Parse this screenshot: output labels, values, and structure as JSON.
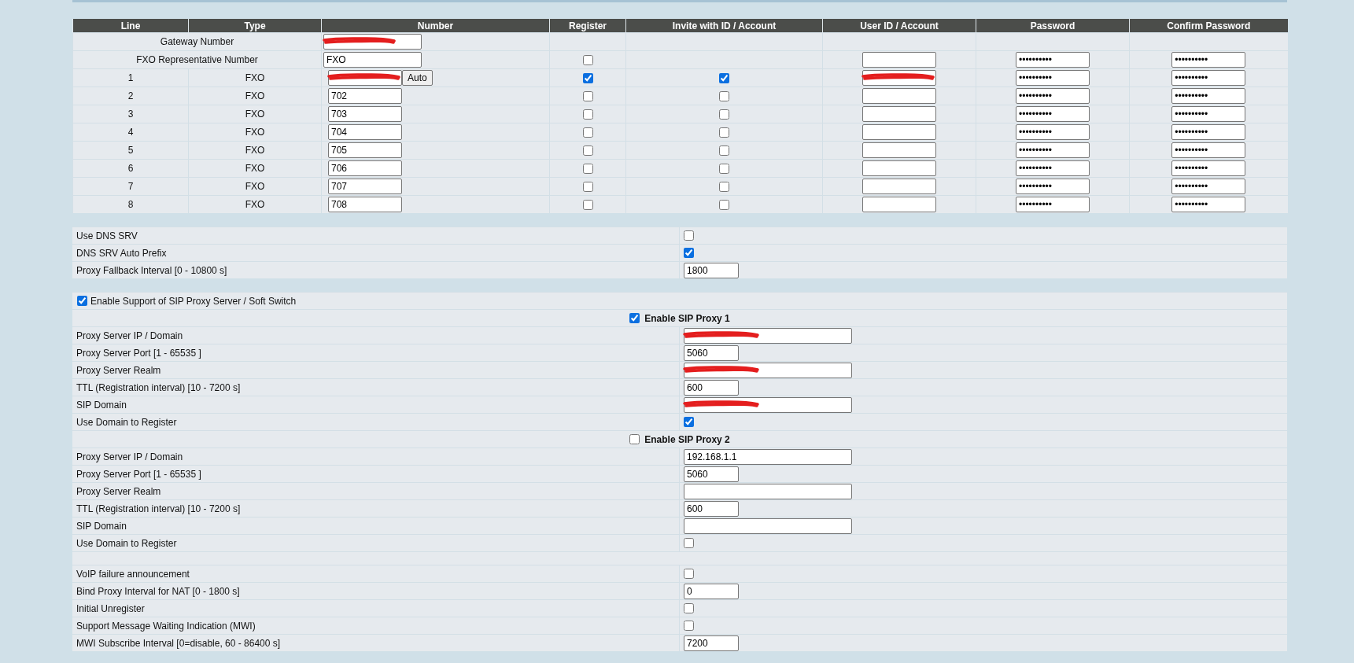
{
  "line_table": {
    "columns": [
      "Line",
      "Type",
      "Number",
      "Register",
      "Invite with ID / Account",
      "User ID / Account",
      "Password",
      "Confirm Password"
    ],
    "gateway_row": {
      "label": "Gateway Number",
      "number": {
        "redacted": true
      }
    },
    "representative_row": {
      "label": "FXO Representative Number",
      "number": {
        "value": "FXO",
        "redacted": false
      },
      "register": false,
      "user_id": {
        "redacted": false
      },
      "password": "••••••••••",
      "confirm_password": "••••••••••"
    },
    "lines": [
      {
        "line": "1",
        "type": "FXO",
        "number": {
          "redacted": true
        },
        "auto_button": "Auto",
        "register": true,
        "invite_with_id": true,
        "user_id": {
          "redacted": true
        },
        "password": "••••••••••",
        "confirm_password": "••••••••••"
      },
      {
        "line": "2",
        "type": "FXO",
        "number": {
          "value": "702",
          "redacted": false
        },
        "register": false,
        "invite_with_id": false,
        "user_id": {
          "redacted": false
        },
        "password": "••••••••••",
        "confirm_password": "••••••••••"
      },
      {
        "line": "3",
        "type": "FXO",
        "number": {
          "value": "703",
          "redacted": false
        },
        "register": false,
        "invite_with_id": false,
        "user_id": {
          "redacted": false
        },
        "password": "••••••••••",
        "confirm_password": "••••••••••"
      },
      {
        "line": "4",
        "type": "FXO",
        "number": {
          "value": "704",
          "redacted": false
        },
        "register": false,
        "invite_with_id": false,
        "user_id": {
          "redacted": false
        },
        "password": "••••••••••",
        "confirm_password": "••••••••••"
      },
      {
        "line": "5",
        "type": "FXO",
        "number": {
          "value": "705",
          "redacted": false
        },
        "register": false,
        "invite_with_id": false,
        "user_id": {
          "redacted": false
        },
        "password": "••••••••••",
        "confirm_password": "••••••••••"
      },
      {
        "line": "6",
        "type": "FXO",
        "number": {
          "value": "706",
          "redacted": false
        },
        "register": false,
        "invite_with_id": false,
        "user_id": {
          "redacted": false
        },
        "password": "••••••••••",
        "confirm_password": "••••••••••"
      },
      {
        "line": "7",
        "type": "FXO",
        "number": {
          "value": "707",
          "redacted": false
        },
        "register": false,
        "invite_with_id": false,
        "user_id": {
          "redacted": false
        },
        "password": "••••••••••",
        "confirm_password": "••••••••••"
      },
      {
        "line": "8",
        "type": "FXO",
        "number": {
          "value": "708",
          "redacted": false
        },
        "register": false,
        "invite_with_id": false,
        "user_id": {
          "redacted": false
        },
        "password": "••••••••••",
        "confirm_password": "••••••••••"
      }
    ]
  },
  "sections": [
    {
      "rows": [
        {
          "kind": "checkbox",
          "label": "Use DNS SRV",
          "checked": false
        },
        {
          "kind": "checkbox",
          "label": "DNS SRV Auto Prefix",
          "checked": true
        },
        {
          "kind": "short_field",
          "label": "Proxy Fallback Interval [0 - 10800 s]",
          "value": "1800",
          "redacted": false
        }
      ]
    },
    {
      "rows": [
        {
          "kind": "master",
          "label": "Enable Support of SIP Proxy Server / Soft Switch",
          "checked": true
        },
        {
          "kind": "heading",
          "label": "Enable SIP Proxy 1",
          "checked": true
        },
        {
          "kind": "long_field",
          "label": "Proxy Server IP / Domain",
          "redacted": true
        },
        {
          "kind": "short_field",
          "label": "Proxy Server Port [1 - 65535 ]",
          "value": "5060",
          "redacted": false
        },
        {
          "kind": "long_field",
          "label": "Proxy Server Realm",
          "redacted": true
        },
        {
          "kind": "short_field",
          "label": "TTL (Registration interval) [10 - 7200 s]",
          "value": "600",
          "redacted": false
        },
        {
          "kind": "long_field",
          "label": "SIP Domain",
          "redacted": true
        },
        {
          "kind": "checkbox",
          "label": "Use Domain to Register",
          "checked": true
        },
        {
          "kind": "heading",
          "label": "Enable SIP Proxy 2",
          "checked": false
        },
        {
          "kind": "long_field",
          "label": "Proxy Server IP / Domain",
          "value": "192.168.1.1",
          "redacted": false
        },
        {
          "kind": "short_field",
          "label": "Proxy Server Port [1 - 65535 ]",
          "value": "5060",
          "redacted": false
        },
        {
          "kind": "long_field",
          "label": "Proxy Server Realm",
          "redacted": false
        },
        {
          "kind": "short_field",
          "label": "TTL (Registration interval) [10 - 7200 s]",
          "value": "600",
          "redacted": false
        },
        {
          "kind": "long_field",
          "label": "SIP Domain",
          "redacted": false
        },
        {
          "kind": "checkbox",
          "label": "Use Domain to Register",
          "checked": false
        },
        {
          "kind": "blank"
        },
        {
          "kind": "checkbox",
          "label": "VoIP failure announcement",
          "checked": false
        },
        {
          "kind": "short_field",
          "label": "Bind Proxy Interval for NAT [0 - 1800 s]",
          "value": "0",
          "redacted": false
        },
        {
          "kind": "checkbox",
          "label": "Initial Unregister",
          "checked": false
        },
        {
          "kind": "checkbox",
          "label": "Support Message Waiting Indication (MWI)",
          "checked": false
        },
        {
          "kind": "short_field",
          "label": "MWI Subscribe Interval [0=disable, 60 - 86400 s]",
          "value": "7200",
          "redacted": false
        }
      ]
    }
  ]
}
